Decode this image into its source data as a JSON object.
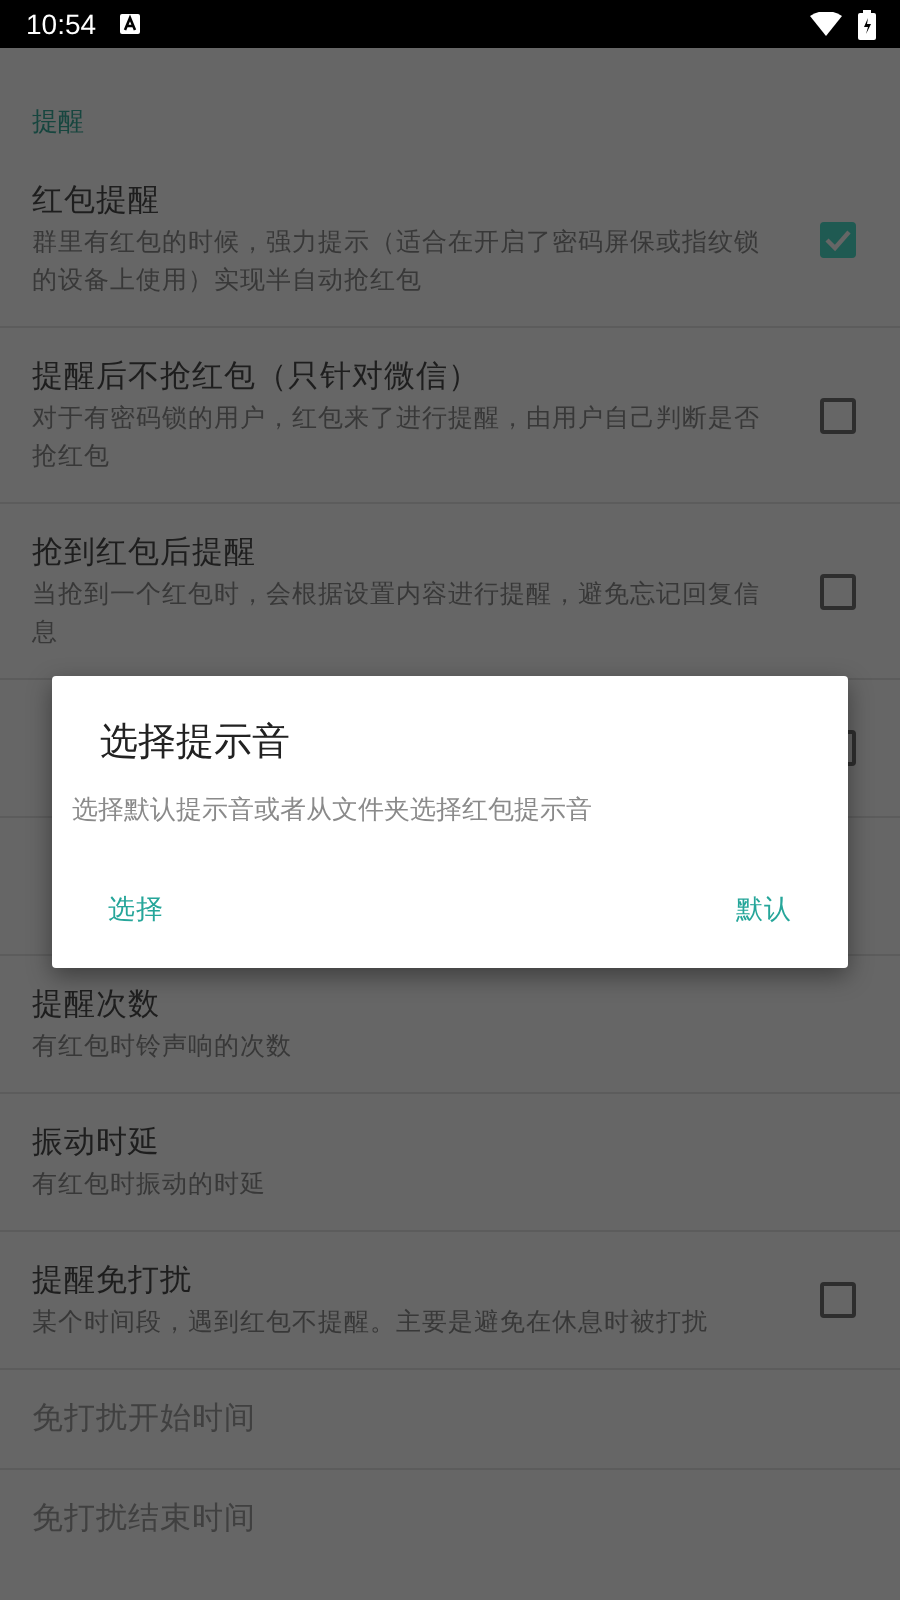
{
  "status_bar": {
    "time": "10:54"
  },
  "section": {
    "title": "提醒"
  },
  "items": [
    {
      "kind": "checkbox",
      "title": "红包提醒",
      "summary": "群里有红包的时候，强力提示（适合在开启了密码屏保或指纹锁的设备上使用）实现半自动抢红包",
      "checked": true,
      "disabled": false
    },
    {
      "kind": "checkbox",
      "title": "提醒后不抢红包（只针对微信）",
      "summary": "对于有密码锁的用户，红包来了进行提醒，由用户自己判断是否抢红包",
      "checked": false,
      "disabled": false
    },
    {
      "kind": "checkbox",
      "title": "抢到红包后提醒",
      "summary": "当抢到一个红包时，会根据设置内容进行提醒，避免忘记回复信息",
      "checked": false,
      "disabled": false
    },
    {
      "kind": "checkbox",
      "checked": false
    },
    {
      "kind": "plain"
    },
    {
      "kind": "plain",
      "title": "提醒次数",
      "summary": "有红包时铃声响的次数",
      "disabled": false
    },
    {
      "kind": "plain",
      "title": "振动时延",
      "summary": "有红包时振动的时延",
      "disabled": false
    },
    {
      "kind": "checkbox",
      "title": "提醒免打扰",
      "summary": "某个时间段，遇到红包不提醒。主要是避免在休息时被打扰",
      "checked": false,
      "disabled": false
    },
    {
      "kind": "plain",
      "title": "免打扰开始时间",
      "disabled": true
    },
    {
      "kind": "plain",
      "title": "免打扰结束时间",
      "disabled": true
    }
  ],
  "dialog": {
    "title": "选择提示音",
    "message": "选择默认提示音或者从文件夹选择红包提示音",
    "buttons": [
      "选择",
      "默认"
    ]
  }
}
